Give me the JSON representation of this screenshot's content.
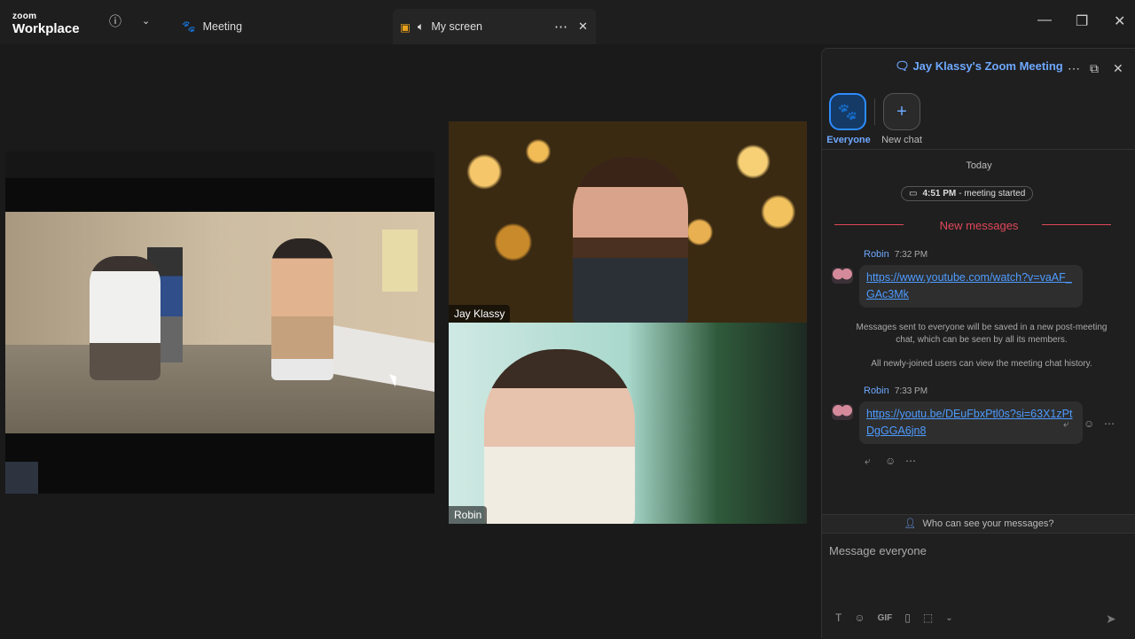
{
  "app": {
    "brand_top": "zoom",
    "brand_bottom": "Workplace"
  },
  "titlebar": {
    "meeting_tab": "Meeting",
    "screen_tab": "My screen"
  },
  "videos": {
    "jay_name": "Jay Klassy",
    "robin_name": "Robin"
  },
  "chat": {
    "title": "Jay Klassy's Zoom Meeting",
    "everyone_label": "Everyone",
    "newchat_label": "New chat",
    "date_label": "Today",
    "meeting_started_time": "4:51 PM",
    "meeting_started_text": "- meeting started",
    "new_messages": "New messages",
    "messages": [
      {
        "sender": "Robin",
        "time": "7:32 PM",
        "text": "https://www.youtube.com/watch?v=vaAF_GAc3Mk"
      },
      {
        "sender": "Robin",
        "time": "7:33 PM",
        "text": "https://youtu.be/DEuFbxPtl0s?si=63X1zPtDgGGA6jn8"
      }
    ],
    "note1": "Messages sent to everyone will be saved in a new post-meeting chat, which can be seen by all its members.",
    "note2": "All newly-joined users can view the meeting chat history.",
    "who_can_see": "Who can see your messages?",
    "input_placeholder": "Message everyone",
    "gif_label": "GIF"
  },
  "icons": [
    "info-icon",
    "chevron-down-icon",
    "paw-icon",
    "share-screen-icon",
    "speaker-icon",
    "more-icon",
    "close-icon",
    "minimize-icon",
    "restore-icon",
    "window-close-icon",
    "chat-icon",
    "popout-icon",
    "plus-icon",
    "reply-icon",
    "emoji-icon",
    "format-icon",
    "file-icon",
    "screenshot-icon",
    "send-icon",
    "person-lock-icon",
    "video-icon"
  ],
  "colors": {
    "accent": "#2d8cff",
    "link": "#4d9bff",
    "new_messages": "#e0485a"
  }
}
